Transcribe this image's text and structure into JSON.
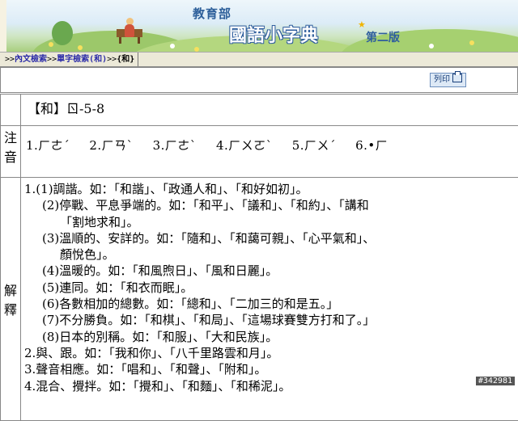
{
  "banner": {
    "ministry": "教育部",
    "title": "國語小字典",
    "edition": "第二版"
  },
  "breadcrumb": {
    "prefix1": ">>",
    "link1": "內文檢索",
    "prefix2": ">>",
    "link2": "單字檢索(和)",
    "prefix3": ">>",
    "current": "{和}"
  },
  "toolbar": {
    "print_label": "列印"
  },
  "entry": {
    "headword": "【和】ㄖ-5-8",
    "zhuyin_label_1": "注",
    "zhuyin_label_2": "音",
    "readings": [
      "1.ㄏㄜˊ",
      "2.ㄏㄢˋ",
      "3.ㄏㄜˋ",
      "4.ㄏㄨㄛˋ",
      "5.ㄏㄨˊ",
      "6.•ㄏ"
    ],
    "def_label_1": "解",
    "def_label_2": "釋",
    "definitions": [
      "1.(1)調諧。如：「和諧」、「政通人和」、「和好如初」。",
      "(2)停戰、平息爭端的。如：「和平」、「議和」、「和約」、「講和",
      "「割地求和」。",
      "(3)溫順的、安詳的。如：「隨和」、「和藹可親」、「心平氣和」、",
      "顏悅色」。",
      "(4)溫暖的。如：「和風煦日」、「風和日麗」。",
      "(5)連同。如：「和衣而眠」。",
      "(6)各數相加的總數。如：「總和」、「二加三的和是五。」",
      "(7)不分勝負。如：「和棋」、「和局」、「這場球賽雙方打和了。」",
      "(8)日本的別稱。如：「和服」、「大和民族」。",
      "2.與、跟。如：「我和你」、「八千里路雲和月」。",
      "3.聲音相應。如：「唱和」、「和聲」、「附和」。",
      "4.混合、攪拌。如：「攪和」、「和麵」、「和稀泥」。"
    ]
  },
  "watermark": "#342981"
}
